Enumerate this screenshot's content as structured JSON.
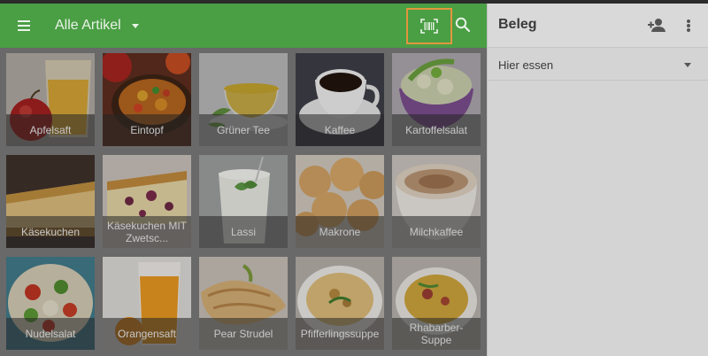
{
  "colors": {
    "accent": "#4a9e44",
    "highlight": "#e3953f"
  },
  "appbar": {
    "menu_icon": "hamburger-menu-icon",
    "category": "Alle Artikel",
    "barcode_icon": "barcode-scan-icon",
    "search_icon": "search-icon"
  },
  "products": [
    {
      "name": "Apfelsaft"
    },
    {
      "name": "Eintopf"
    },
    {
      "name": "Grüner Tee"
    },
    {
      "name": "Kaffee"
    },
    {
      "name": "Kartoffelsalat"
    },
    {
      "name": "Käsekuchen"
    },
    {
      "name": "Käsekuchen MIT Zwetsc..."
    },
    {
      "name": "Lassi"
    },
    {
      "name": "Makrone"
    },
    {
      "name": "Milchkaffee"
    },
    {
      "name": "Nudelsalat"
    },
    {
      "name": "Orangensaft"
    },
    {
      "name": "Pear Strudel"
    },
    {
      "name": "Pfifferlingssuppe"
    },
    {
      "name": "Rhabarber-Suppe"
    }
  ],
  "receipt": {
    "title": "Beleg",
    "add_customer_icon": "add-person-icon",
    "more_icon": "more-vert-icon",
    "order_type": "Hier essen"
  }
}
